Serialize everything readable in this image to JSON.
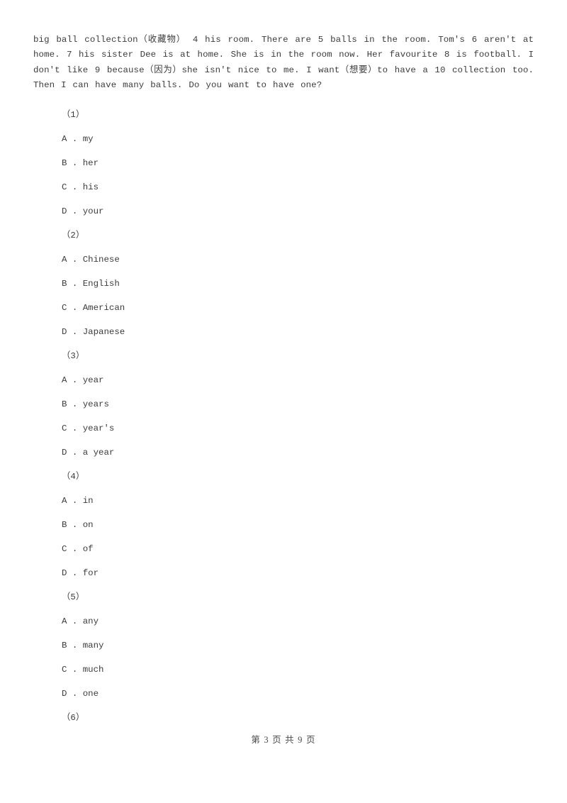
{
  "document": {
    "passage_text": "big ball collection（收藏物） 4  his room. There are 5  balls in the room. Tom's  6  aren't at home.  7  his sister Dee is at home. She is in the room now. Her favourite 8  is football. I don't like  9  because（因为）she isn't nice to me. I want（想要）to have a 10 collection too. Then I can have many balls. Do you want to have one?"
  },
  "questions": [
    {
      "number": "（1）",
      "options": [
        "A . my",
        "B . her",
        "C . his",
        "D . your"
      ]
    },
    {
      "number": "（2）",
      "options": [
        "A . Chinese",
        "B . English",
        "C . American",
        "D . Japanese"
      ]
    },
    {
      "number": "（3）",
      "options": [
        "A . year",
        "B . years",
        "C . year's",
        "D . a year"
      ]
    },
    {
      "number": "（4）",
      "options": [
        "A . in",
        "B . on",
        "C . of",
        "D . for"
      ]
    },
    {
      "number": "（5）",
      "options": [
        "A . any",
        "B . many",
        "C . much",
        "D . one"
      ]
    },
    {
      "number": "（6）",
      "options": []
    }
  ],
  "footer": {
    "page_label": "第 3 页 共 9 页",
    "current_page": 3,
    "total_pages": 9
  }
}
